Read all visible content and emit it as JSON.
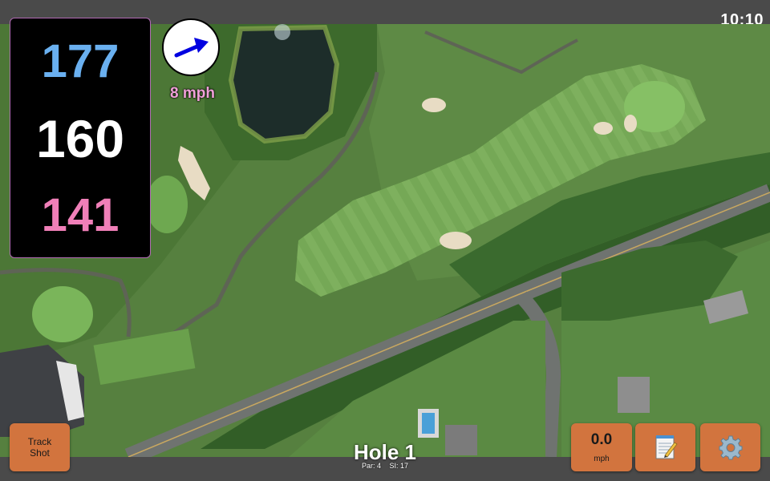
{
  "status_bar": {
    "time": "10:10"
  },
  "distances": {
    "back": "177",
    "middle": "160",
    "front": "141"
  },
  "wind": {
    "speed_label": "8 mph",
    "direction_icon": "wind-arrow-icon"
  },
  "hole": {
    "title": "Hole 1",
    "par_label": "Par: 4",
    "stroke_index_label": "SI: 17"
  },
  "buttons": {
    "track_shot_line1": "Track",
    "track_shot_line2": "Shot",
    "speed_value": "0.0",
    "speed_unit": "mph",
    "notes_icon": "notepad-icon",
    "settings_icon": "gear-icon"
  },
  "colors": {
    "back_distance": "#6ab0f0",
    "middle_distance": "#ffffff",
    "front_distance": "#f07fb8",
    "button_bg": "#d2743e",
    "bar_bg": "#4a4a4a"
  }
}
